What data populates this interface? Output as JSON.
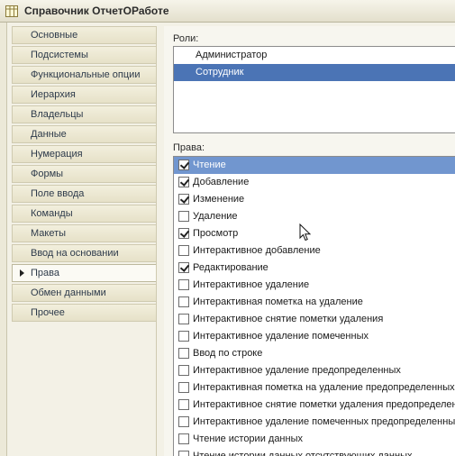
{
  "window": {
    "title": "Справочник ОтчетОРаботе",
    "icon": "table-icon"
  },
  "sidebar": {
    "items": [
      {
        "label": "Основные"
      },
      {
        "label": "Подсистемы"
      },
      {
        "label": "Функциональные опции"
      },
      {
        "label": "Иерархия"
      },
      {
        "label": "Владельцы"
      },
      {
        "label": "Данные"
      },
      {
        "label": "Нумерация"
      },
      {
        "label": "Формы"
      },
      {
        "label": "Поле ввода"
      },
      {
        "label": "Команды"
      },
      {
        "label": "Макеты"
      },
      {
        "label": "Ввод на основании"
      },
      {
        "label": "Права",
        "active": true
      },
      {
        "label": "Обмен данными"
      },
      {
        "label": "Прочее"
      }
    ]
  },
  "roles": {
    "label": "Роли:",
    "items": [
      {
        "label": "Администратор",
        "selected": false
      },
      {
        "label": "Сотрудник",
        "selected": true
      }
    ]
  },
  "rights": {
    "label": "Права:",
    "items": [
      {
        "label": "Чтение",
        "checked": true,
        "selected": true
      },
      {
        "label": "Добавление",
        "checked": true
      },
      {
        "label": "Изменение",
        "checked": true
      },
      {
        "label": "Удаление",
        "checked": false
      },
      {
        "label": "Просмотр",
        "checked": true
      },
      {
        "label": "Интерактивное добавление",
        "checked": false
      },
      {
        "label": "Редактирование",
        "checked": true
      },
      {
        "label": "Интерактивное удаление",
        "checked": false
      },
      {
        "label": "Интерактивная пометка на удаление",
        "checked": false
      },
      {
        "label": "Интерактивное снятие пометки удаления",
        "checked": false
      },
      {
        "label": "Интерактивное удаление помеченных",
        "checked": false
      },
      {
        "label": "Ввод по строке",
        "checked": false
      },
      {
        "label": "Интерактивное удаление предопределенных",
        "checked": false
      },
      {
        "label": "Интерактивная пометка на удаление предопределенных",
        "checked": false
      },
      {
        "label": "Интерактивное снятие пометки удаления предопределенных",
        "checked": false
      },
      {
        "label": "Интерактивное удаление помеченных предопределенных",
        "checked": false
      },
      {
        "label": "Чтение истории данных",
        "checked": false
      },
      {
        "label": "Чтение истории данных отсутствующих данных",
        "checked": false
      }
    ]
  },
  "colors": {
    "selection": "#4b74b5",
    "rights_selection": "#7196cf"
  }
}
